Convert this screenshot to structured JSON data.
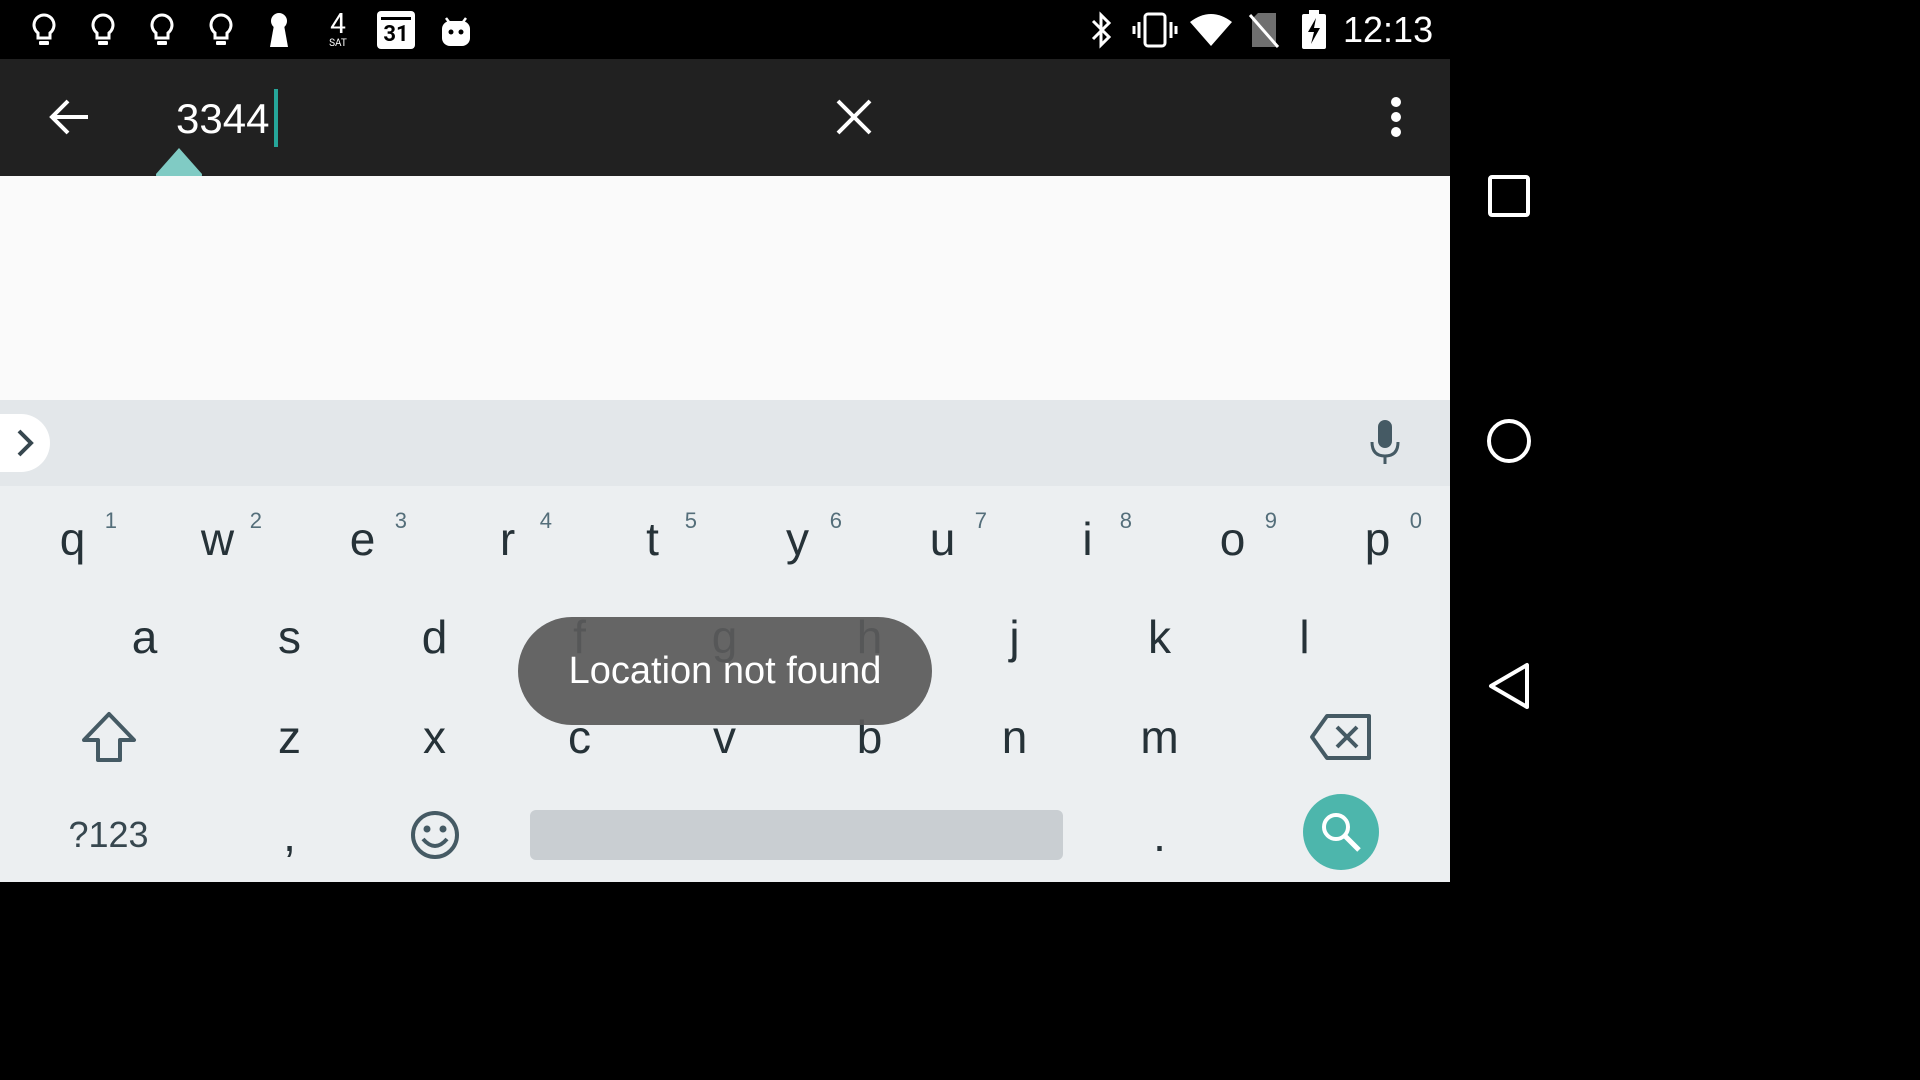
{
  "status_bar": {
    "notification_icons": [
      "bulb-icon",
      "bulb-icon",
      "bulb-icon",
      "bulb-icon",
      "keyhole-icon",
      "weather-sat-icon",
      "calendar-icon",
      "android-icon"
    ],
    "weather_day_number": "4",
    "weather_day_label": "SAT",
    "calendar_day": "31",
    "system_icons": [
      "bluetooth-icon",
      "vibrate-icon",
      "wifi-icon",
      "no-sim-icon",
      "battery-charging-icon"
    ],
    "time": "12:13"
  },
  "toolbar": {
    "back_icon": "arrow-back-icon",
    "search_value": "3344",
    "clear_icon": "close-icon",
    "more_icon": "more-vert-icon"
  },
  "keyboard": {
    "row1": [
      {
        "letter": "q",
        "hint": "1"
      },
      {
        "letter": "w",
        "hint": "2"
      },
      {
        "letter": "e",
        "hint": "3"
      },
      {
        "letter": "r",
        "hint": "4"
      },
      {
        "letter": "t",
        "hint": "5"
      },
      {
        "letter": "y",
        "hint": "6"
      },
      {
        "letter": "u",
        "hint": "7"
      },
      {
        "letter": "i",
        "hint": "8"
      },
      {
        "letter": "o",
        "hint": "9"
      },
      {
        "letter": "p",
        "hint": "0"
      }
    ],
    "row2": [
      "a",
      "s",
      "d",
      "f",
      "g",
      "h",
      "j",
      "k",
      "l"
    ],
    "row3": [
      "z",
      "x",
      "c",
      "v",
      "b",
      "n",
      "m"
    ],
    "symbols_label": "?123",
    "comma_label": ",",
    "period_label": "."
  },
  "toast": {
    "message": "Location not found"
  },
  "navigation": {
    "recents_icon": "recents-square-icon",
    "home_icon": "home-circle-icon",
    "back_icon": "back-triangle-icon"
  },
  "colors": {
    "accent": "#26a69a",
    "search_key": "#4db6ac",
    "toolbar": "#212121",
    "keyboard_bg": "#eceff1"
  }
}
